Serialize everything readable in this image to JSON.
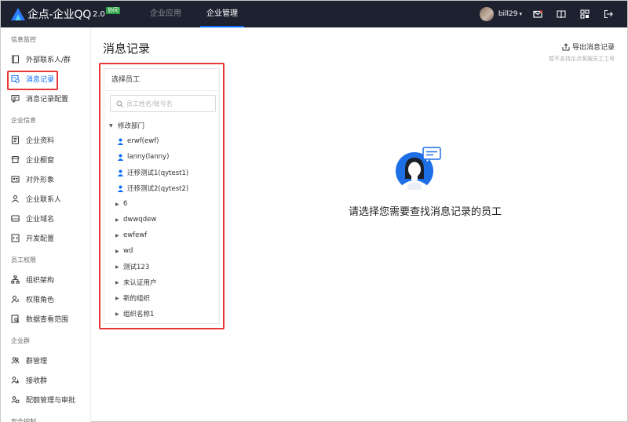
{
  "header": {
    "brand": "企点-企业QQ",
    "version": "2.0",
    "badge": "协同",
    "nav": [
      {
        "label": "企业应用",
        "active": false
      },
      {
        "label": "企业管理",
        "active": true
      }
    ],
    "username": "bill29",
    "icons": [
      "mail-icon",
      "book-icon",
      "apps-grid-icon",
      "logout-icon"
    ]
  },
  "sidebar": {
    "groups": [
      {
        "label": "信息监控",
        "items": [
          {
            "label": "外部联系人/群",
            "icon": "contacts-book-icon"
          },
          {
            "label": "消息记录",
            "icon": "message-record-icon",
            "active": true
          },
          {
            "label": "消息记录配置",
            "icon": "message-settings-icon"
          }
        ]
      },
      {
        "label": "企业信息",
        "items": [
          {
            "label": "企业资料",
            "icon": "document-icon"
          },
          {
            "label": "企业橱窗",
            "icon": "storefront-icon"
          },
          {
            "label": "对外形象",
            "icon": "id-card-icon"
          },
          {
            "label": "企业联系人",
            "icon": "contact-person-icon"
          },
          {
            "label": "企业域名",
            "icon": "www-icon"
          },
          {
            "label": "开发配置",
            "icon": "code-icon"
          }
        ]
      },
      {
        "label": "员工权限",
        "items": [
          {
            "label": "组织架构",
            "icon": "org-chart-icon"
          },
          {
            "label": "权限角色",
            "icon": "role-icon"
          },
          {
            "label": "数据查看范围",
            "icon": "data-scope-icon"
          }
        ]
      },
      {
        "label": "企业群",
        "items": [
          {
            "label": "群管理",
            "icon": "group-icon"
          },
          {
            "label": "接收群",
            "icon": "receive-group-icon"
          },
          {
            "label": "配额管理与审批",
            "icon": "quota-approval-icon"
          }
        ]
      },
      {
        "label": "安全控制",
        "items": []
      }
    ]
  },
  "main": {
    "title": "消息记录",
    "export_label": "导出消息记录",
    "export_note": "暂不支持企点客服员工工号",
    "panel": {
      "title": "选择员工",
      "search_placeholder": "员工姓名/账号名",
      "root": "修改部门",
      "users": [
        "erwf(ewf)",
        "lanny(lanny)",
        "迁移测试1(qytest1)",
        "迁移测试2(qytest2)"
      ],
      "departments": [
        "6",
        "dwwqdew",
        "ewfewf",
        "wd",
        "测试123",
        "未认证用户",
        "新的组织",
        "组织名称1"
      ]
    },
    "empty_text": "请选择您需要查找消息记录的员工"
  },
  "colors": {
    "topbar": "#1d2130",
    "accent": "#0a6cff",
    "highlight": "#e53935"
  }
}
